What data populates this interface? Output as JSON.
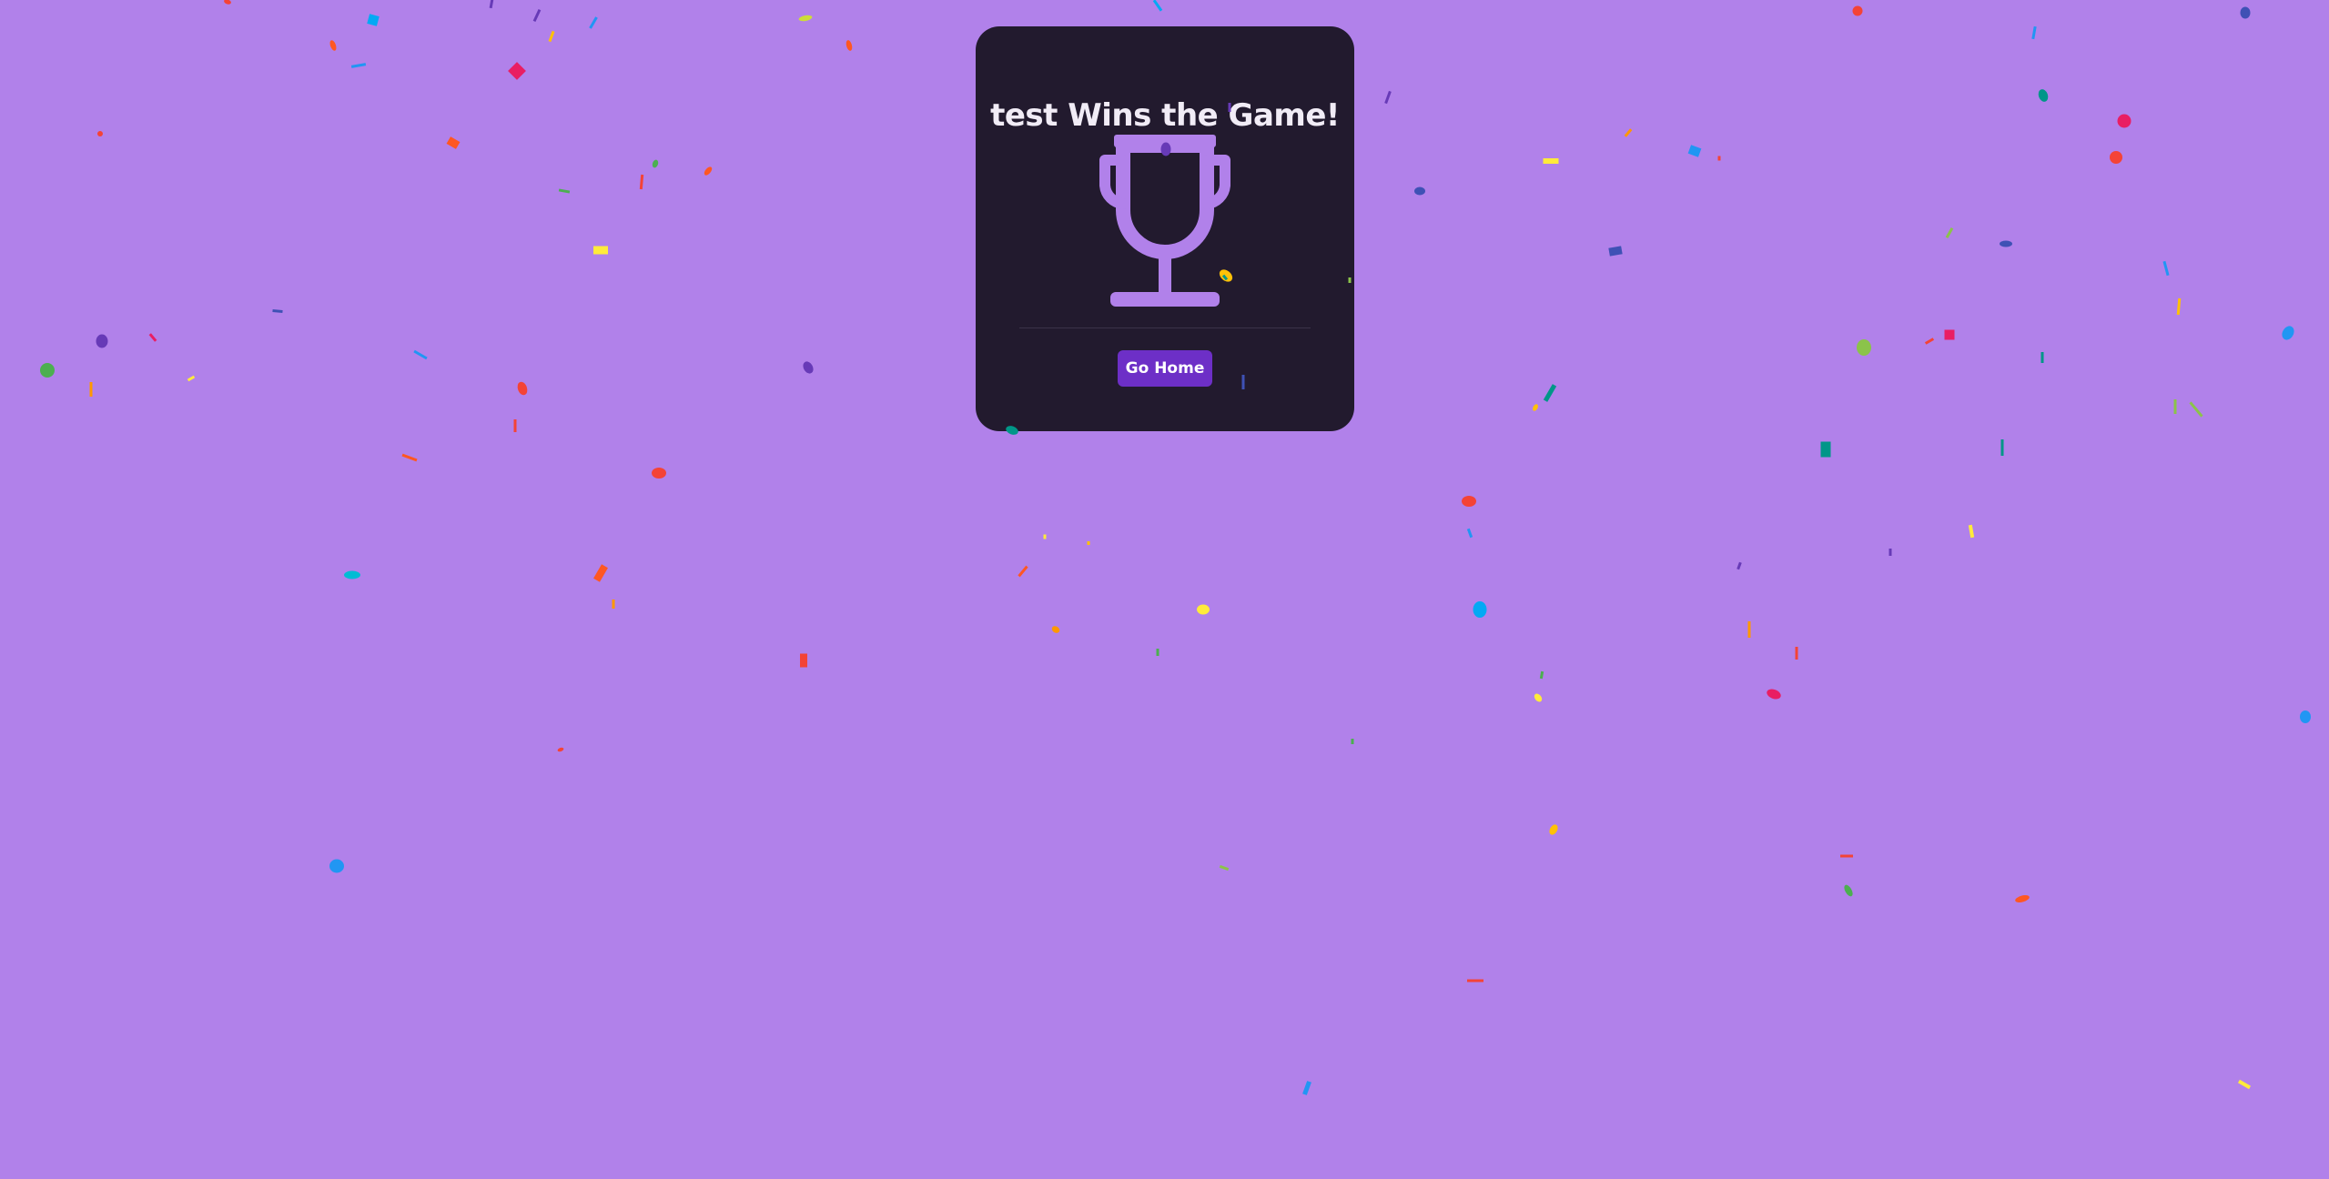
{
  "page": {
    "background": "#b181ea"
  },
  "win_card": {
    "title": "test Wins the Game!",
    "trophy_icon": "trophy-icon",
    "trophy_color": "#b181ea",
    "background": "#221a2e"
  },
  "actions": {
    "go_home_label": "Go Home",
    "button_color": "#6d2fc7"
  },
  "confetti": {
    "palette": [
      "#f44336",
      "#e91e63",
      "#9c27b0",
      "#673ab7",
      "#3f51b5",
      "#2196f3",
      "#03a9f4",
      "#00bcd4",
      "#009688",
      "#4caf50",
      "#8bc34a",
      "#cddc39",
      "#ffeb3b",
      "#ffc107",
      "#ff9800",
      "#ff5722",
      "#795548"
    ]
  }
}
